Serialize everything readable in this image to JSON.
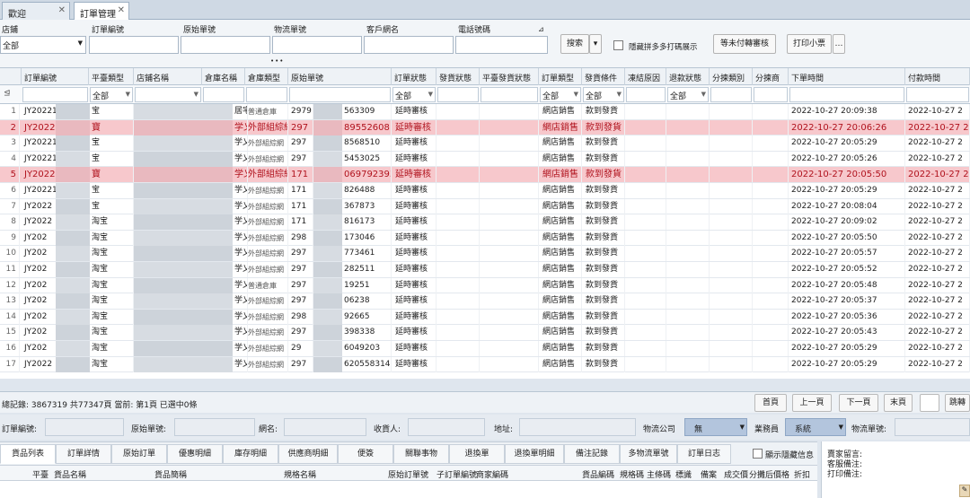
{
  "tabs": [
    {
      "label": "歡迎"
    },
    {
      "label": "訂單管理"
    }
  ],
  "filters": {
    "store": {
      "label": "店鋪",
      "value": "全部"
    },
    "order_no": {
      "label": "訂單編號",
      "value": ""
    },
    "origin_no": {
      "label": "原始單號",
      "value": ""
    },
    "logistics_no": {
      "label": "物流單號",
      "value": ""
    },
    "customer": {
      "label": "客戶網名",
      "value": ""
    },
    "phone": {
      "label": "電話號碼",
      "value": ""
    },
    "search_btn": "搜索",
    "merge_label": "隱藏拼多多打碼展示",
    "pending_btn": "等未付轉審核",
    "print_btn": "打印小票",
    "more": "…",
    "grip": "•••"
  },
  "grid": {
    "headers": [
      "訂單編號",
      "平臺類型",
      "店鋪名稱",
      "倉庫名稱",
      "倉庫類型",
      "原始單號",
      "訂單狀態",
      "發貨狀態",
      "平臺發貨狀態",
      "訂單類型",
      "發貨條件",
      "凍結原因",
      "退款狀態",
      "分揀類別",
      "分揀商",
      "下單時間",
      "付款時間"
    ],
    "filter_all": "全部",
    "rows": [
      {
        "n": "1",
        "id": "JY202210",
        "plat": "宝",
        "wh": "居宅",
        "wtype": "普通倉庫",
        "o1": "2979",
        "o2": "563309",
        "st": "延時審核",
        "ot": "網店銷售",
        "cond": "款到發貨",
        "t1": "2022-10-27 20:09:38",
        "t2": "2022-10-27 2",
        "hl": false
      },
      {
        "n": "2",
        "id": "JY20221",
        "plat": "寶",
        "wh": "学乂",
        "wtype": "外部組綜網",
        "o1": "297",
        "o2": "89552608",
        "st": "延時審核",
        "ot": "網店銷售",
        "cond": "款到發貨",
        "t1": "2022-10-27 20:06:26",
        "t2": "2022-10-27 2",
        "hl": true
      },
      {
        "n": "3",
        "id": "JY20221",
        "plat": "宝",
        "wh": "学乂",
        "wtype": "外部組綜網",
        "o1": "297",
        "o2": "8568510",
        "st": "延時審核",
        "ot": "網店銷售",
        "cond": "款到發貨",
        "t1": "2022-10-27 20:05:29",
        "t2": "2022-10-27 2",
        "hl": false
      },
      {
        "n": "4",
        "id": "JY20221",
        "plat": "宝",
        "wh": "学乂",
        "wtype": "外部組綜網",
        "o1": "297",
        "o2": "5453025",
        "st": "延時審核",
        "ot": "網店銷售",
        "cond": "款到發貨",
        "t1": "2022-10-27 20:05:26",
        "t2": "2022-10-27 2",
        "hl": false
      },
      {
        "n": "5",
        "id": "JY20221",
        "plat": "寶",
        "wh": "学乂",
        "wtype": "外部組綜網",
        "o1": "171",
        "o2": "069792393",
        "st": "延時審核",
        "ot": "網店銷售",
        "cond": "款到發貨",
        "t1": "2022-10-27 20:05:50",
        "t2": "2022-10-27 2",
        "hl": true
      },
      {
        "n": "6",
        "id": "JY20221",
        "plat": "宝",
        "wh": "学乂",
        "wtype": "外部組綜網",
        "o1": "171",
        "o2": "826488",
        "st": "延時審核",
        "ot": "網店銷售",
        "cond": "款到發貨",
        "t1": "2022-10-27 20:05:29",
        "t2": "2022-10-27 2",
        "hl": false
      },
      {
        "n": "7",
        "id": "JY2022",
        "plat": "宝",
        "wh": "学乂",
        "wtype": "外部組綜網",
        "o1": "171",
        "o2": "367873",
        "st": "延時審核",
        "ot": "網店銷售",
        "cond": "款到發貨",
        "t1": "2022-10-27 20:08:04",
        "t2": "2022-10-27 2",
        "hl": false
      },
      {
        "n": "8",
        "id": "JY2022",
        "plat": "淘宝",
        "wh": "学乂",
        "wtype": "外部組綜網",
        "o1": "171",
        "o2": "816173",
        "st": "延時審核",
        "ot": "網店銷售",
        "cond": "款到發貨",
        "t1": "2022-10-27 20:09:02",
        "t2": "2022-10-27 2",
        "hl": false
      },
      {
        "n": "9",
        "id": "JY202",
        "plat": "淘宝",
        "wh": "学乂",
        "wtype": "外部組綜網",
        "o1": "298",
        "o2": "173046",
        "st": "延時審核",
        "ot": "網店銷售",
        "cond": "款到發貨",
        "t1": "2022-10-27 20:05:50",
        "t2": "2022-10-27 2",
        "hl": false
      },
      {
        "n": "10",
        "id": "JY202",
        "plat": "淘宝",
        "wh": "学乂",
        "wtype": "外部組綜網",
        "o1": "297",
        "o2": "773461",
        "st": "延時審核",
        "ot": "網店銷售",
        "cond": "款到發貨",
        "t1": "2022-10-27 20:05:57",
        "t2": "2022-10-27 2",
        "hl": false
      },
      {
        "n": "11",
        "id": "JY202",
        "plat": "淘宝",
        "wh": "学乂",
        "wtype": "外部組綜網",
        "o1": "297",
        "o2": "282511",
        "st": "延時審核",
        "ot": "網店銷售",
        "cond": "款到發貨",
        "t1": "2022-10-27 20:05:52",
        "t2": "2022-10-27 2",
        "hl": false
      },
      {
        "n": "12",
        "id": "JY202",
        "plat": "淘宝",
        "wh": "学乂",
        "wtype": "普通倉庫",
        "o1": "297",
        "o2": "19251",
        "st": "延時審核",
        "ot": "網店銷售",
        "cond": "款到發貨",
        "t1": "2022-10-27 20:05:48",
        "t2": "2022-10-27 2",
        "hl": false
      },
      {
        "n": "13",
        "id": "JY202",
        "plat": "淘宝",
        "wh": "学乂",
        "wtype": "外部組綜網",
        "o1": "297",
        "o2": "06238",
        "st": "延時審核",
        "ot": "網店銷售",
        "cond": "款到發貨",
        "t1": "2022-10-27 20:05:37",
        "t2": "2022-10-27 2",
        "hl": false
      },
      {
        "n": "14",
        "id": "JY202",
        "plat": "淘宝",
        "wh": "学乂",
        "wtype": "外部組綜網",
        "o1": "298",
        "o2": "92665",
        "st": "延時審核",
        "ot": "網店銷售",
        "cond": "款到發貨",
        "t1": "2022-10-27 20:05:36",
        "t2": "2022-10-27 2",
        "hl": false
      },
      {
        "n": "15",
        "id": "JY202",
        "plat": "淘宝",
        "wh": "学乂",
        "wtype": "外部組綜網",
        "o1": "297",
        "o2": "398338",
        "st": "延時審核",
        "ot": "網店銷售",
        "cond": "款到發貨",
        "t1": "2022-10-27 20:05:43",
        "t2": "2022-10-27 2",
        "hl": false
      },
      {
        "n": "16",
        "id": "JY202",
        "plat": "淘宝",
        "wh": "学乂",
        "wtype": "外部組綜網",
        "o1": "29",
        "o2": "6049203",
        "st": "延時審核",
        "ot": "網店銷售",
        "cond": "款到發貨",
        "t1": "2022-10-27 20:05:29",
        "t2": "2022-10-27 2",
        "hl": false
      },
      {
        "n": "17",
        "id": "JY2022",
        "plat": "淘宝",
        "wh": "学乂",
        "wtype": "外部組綜網",
        "o1": "297",
        "o2": "620558314",
        "st": "延時審核",
        "ot": "網店銷售",
        "cond": "款到發貨",
        "t1": "2022-10-27 20:05:29",
        "t2": "2022-10-27 2",
        "hl": false
      }
    ]
  },
  "pager": {
    "summary": "總記錄: 3867319  共77347頁  當前: 第1頁  已選中0條",
    "first": "首頁",
    "prev": "上一頁",
    "next": "下一頁",
    "last": "末頁",
    "goto": "跳轉"
  },
  "details": {
    "order_no": "訂單編號:",
    "origin_no": "原始單號:",
    "nick": "網名:",
    "receiver": "收貨人:",
    "address": "地址:",
    "logistics": "物流公司",
    "logistics_value": "無",
    "clerk": "業務員",
    "clerk_value": "系統",
    "logistics_no": "物流單號:"
  },
  "bottom_tabs": [
    "貨品列表",
    "訂單詳情",
    "原始訂單",
    "優惠明細",
    "庫存明細",
    "供應商明細",
    "便簽",
    "關聯事物",
    "退換單",
    "退換單明細",
    "備注記錄",
    "多物流單號",
    "訂單日志"
  ],
  "show_remark": "顯示隱藏信息",
  "sub_headers": [
    "平臺",
    "貨品名稱",
    "貨品簡稱",
    "規格名稱",
    "原始訂單號",
    "子訂單編號",
    "商家編碼",
    "貨品編碼",
    "規格碼",
    "主條碼",
    "標識",
    "備案",
    "成交價",
    "分攤后價格",
    "折扣"
  ],
  "notes": [
    "賣家留言:",
    "客服備注:",
    "打印備注:"
  ]
}
